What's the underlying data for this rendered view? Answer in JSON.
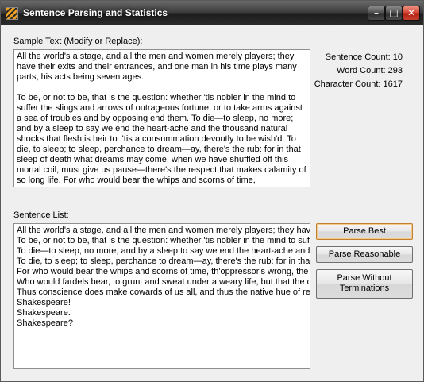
{
  "window": {
    "title": "Sentence Parsing and Statistics"
  },
  "sample": {
    "label": "Sample Text (Modify or Replace):",
    "paragraphs": [
      "All the world's a stage, and all the men and women merely players; they have their exits and their entrances, and one man in his time plays many parts, his acts being seven ages.",
      "To be, or not to be, that is the question:  whether 'tis nobler in the mind to suffer the slings and arrows of outrageous fortune, or to take arms against a sea of troubles and by opposing end them.  To die—to sleep, no more; and by a sleep to say we end the heart-ache and the thousand natural shocks that flesh is heir to: 'tis a consummation devoutly to be wish'd.  To die, to sleep; to sleep, perchance to dream—ay, there's the rub:  for in that sleep of death what dreams may come, when we have shuffled off this mortal coil, must give us pause—there's the respect that makes calamity of so long life.  For who would bear the whips and scorns of time, th'oppressor's wrong, the proud man's"
    ]
  },
  "stats": {
    "sentence_count": "Sentence Count: 10",
    "word_count": "Word Count: 293",
    "character_count": "Character Count: 1617"
  },
  "list": {
    "label": "Sentence List:",
    "items": [
      "All the world's a stage, and all the men and women merely players; they have th",
      "To be, or not to be, that is the question:  whether 'tis nobler in the mind to suffe",
      "To die—to sleep, no more; and by a sleep to say we end the heart-ache and the th",
      "To die, to sleep; to sleep, perchance to dream—ay, there's the rub:  for in that s",
      "For who would bear the whips and scorns of time, th'oppressor's wrong, the pro",
      "Who would fardels bear, to grunt and sweat under a weary life, but that the dre",
      "Thus conscience does make cowards of us all, and thus the native hue of reso",
      "Shakespeare!",
      "Shakespeare.",
      "Shakespeare?"
    ]
  },
  "buttons": {
    "parse_best": "Parse Best",
    "parse_reasonable": "Parse Reasonable",
    "parse_without_terminations": "Parse Without Terminations"
  },
  "icons": {
    "app": "app-icon",
    "minimize": "minimize-icon",
    "maximize": "maximize-icon",
    "close": "close-icon"
  },
  "colors": {
    "default_button_border": "#c08030",
    "close_button": "#c84030"
  }
}
